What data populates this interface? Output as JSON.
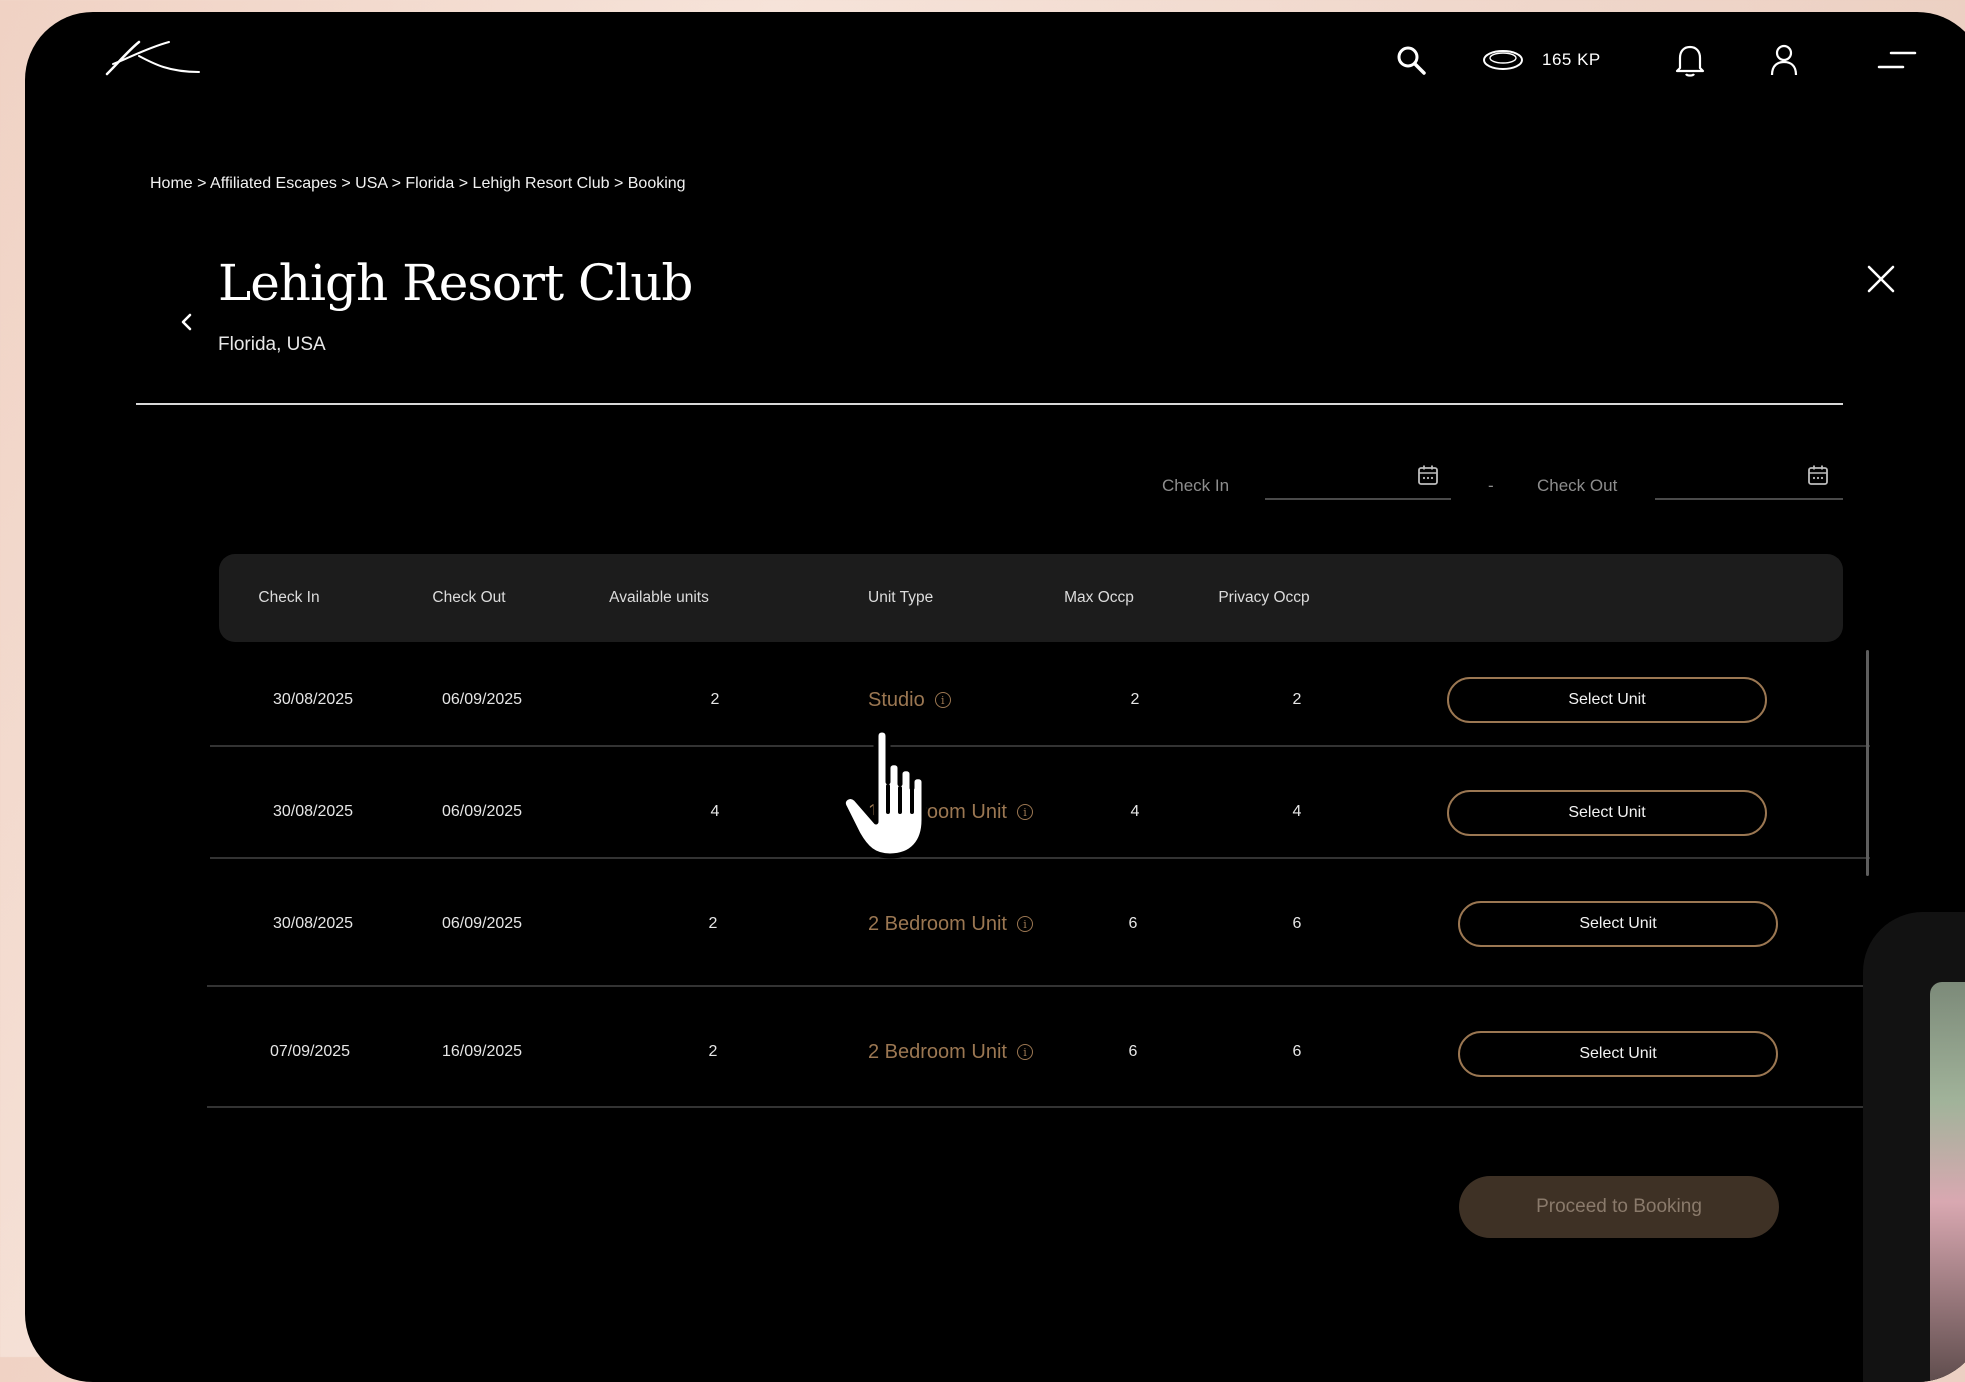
{
  "header": {
    "logo_icon": "k-script-logo",
    "points": "165 KP",
    "icons": [
      "search-icon",
      "coin-icon",
      "bell-icon",
      "user-icon",
      "menu-icon"
    ]
  },
  "breadcrumb": "Home > Affiliated Escapes  > USA > Florida > Lehigh Resort Club > Booking",
  "resort": {
    "title": "Lehigh Resort Club",
    "location": "Florida, USA"
  },
  "date_filter": {
    "check_in_label": "Check In",
    "separator": "-",
    "check_out_label": "Check Out",
    "check_in_value": "",
    "check_out_value": ""
  },
  "table": {
    "columns": [
      "Check In",
      "Check Out",
      "Available units",
      "Unit Type",
      "Max Occp",
      "Privacy Occp"
    ],
    "rows": [
      {
        "check_in": "30/08/2025",
        "check_out": "06/09/2025",
        "available": "2",
        "unit_type": "Studio",
        "max_occp": "2",
        "privacy_occp": "2",
        "action": "Select Unit"
      },
      {
        "check_in": "30/08/2025",
        "check_out": "06/09/2025",
        "available": "4",
        "unit_type": "1 Bedroom Unit",
        "max_occp": "4",
        "privacy_occp": "4",
        "action": "Select Unit"
      },
      {
        "check_in": "30/08/2025",
        "check_out": "06/09/2025",
        "available": "2",
        "unit_type": "2 Bedroom Unit",
        "max_occp": "6",
        "privacy_occp": "6",
        "action": "Select Unit"
      },
      {
        "check_in": "07/09/2025",
        "check_out": "16/09/2025",
        "available": "2",
        "unit_type": "2 Bedroom Unit",
        "max_occp": "6",
        "privacy_occp": "6",
        "action": "Select Unit"
      }
    ]
  },
  "proceed_label": "Proceed to Booking",
  "colors": {
    "accent": "#9b7752",
    "proceed_bg": "#3e3125",
    "background": "#000000"
  }
}
